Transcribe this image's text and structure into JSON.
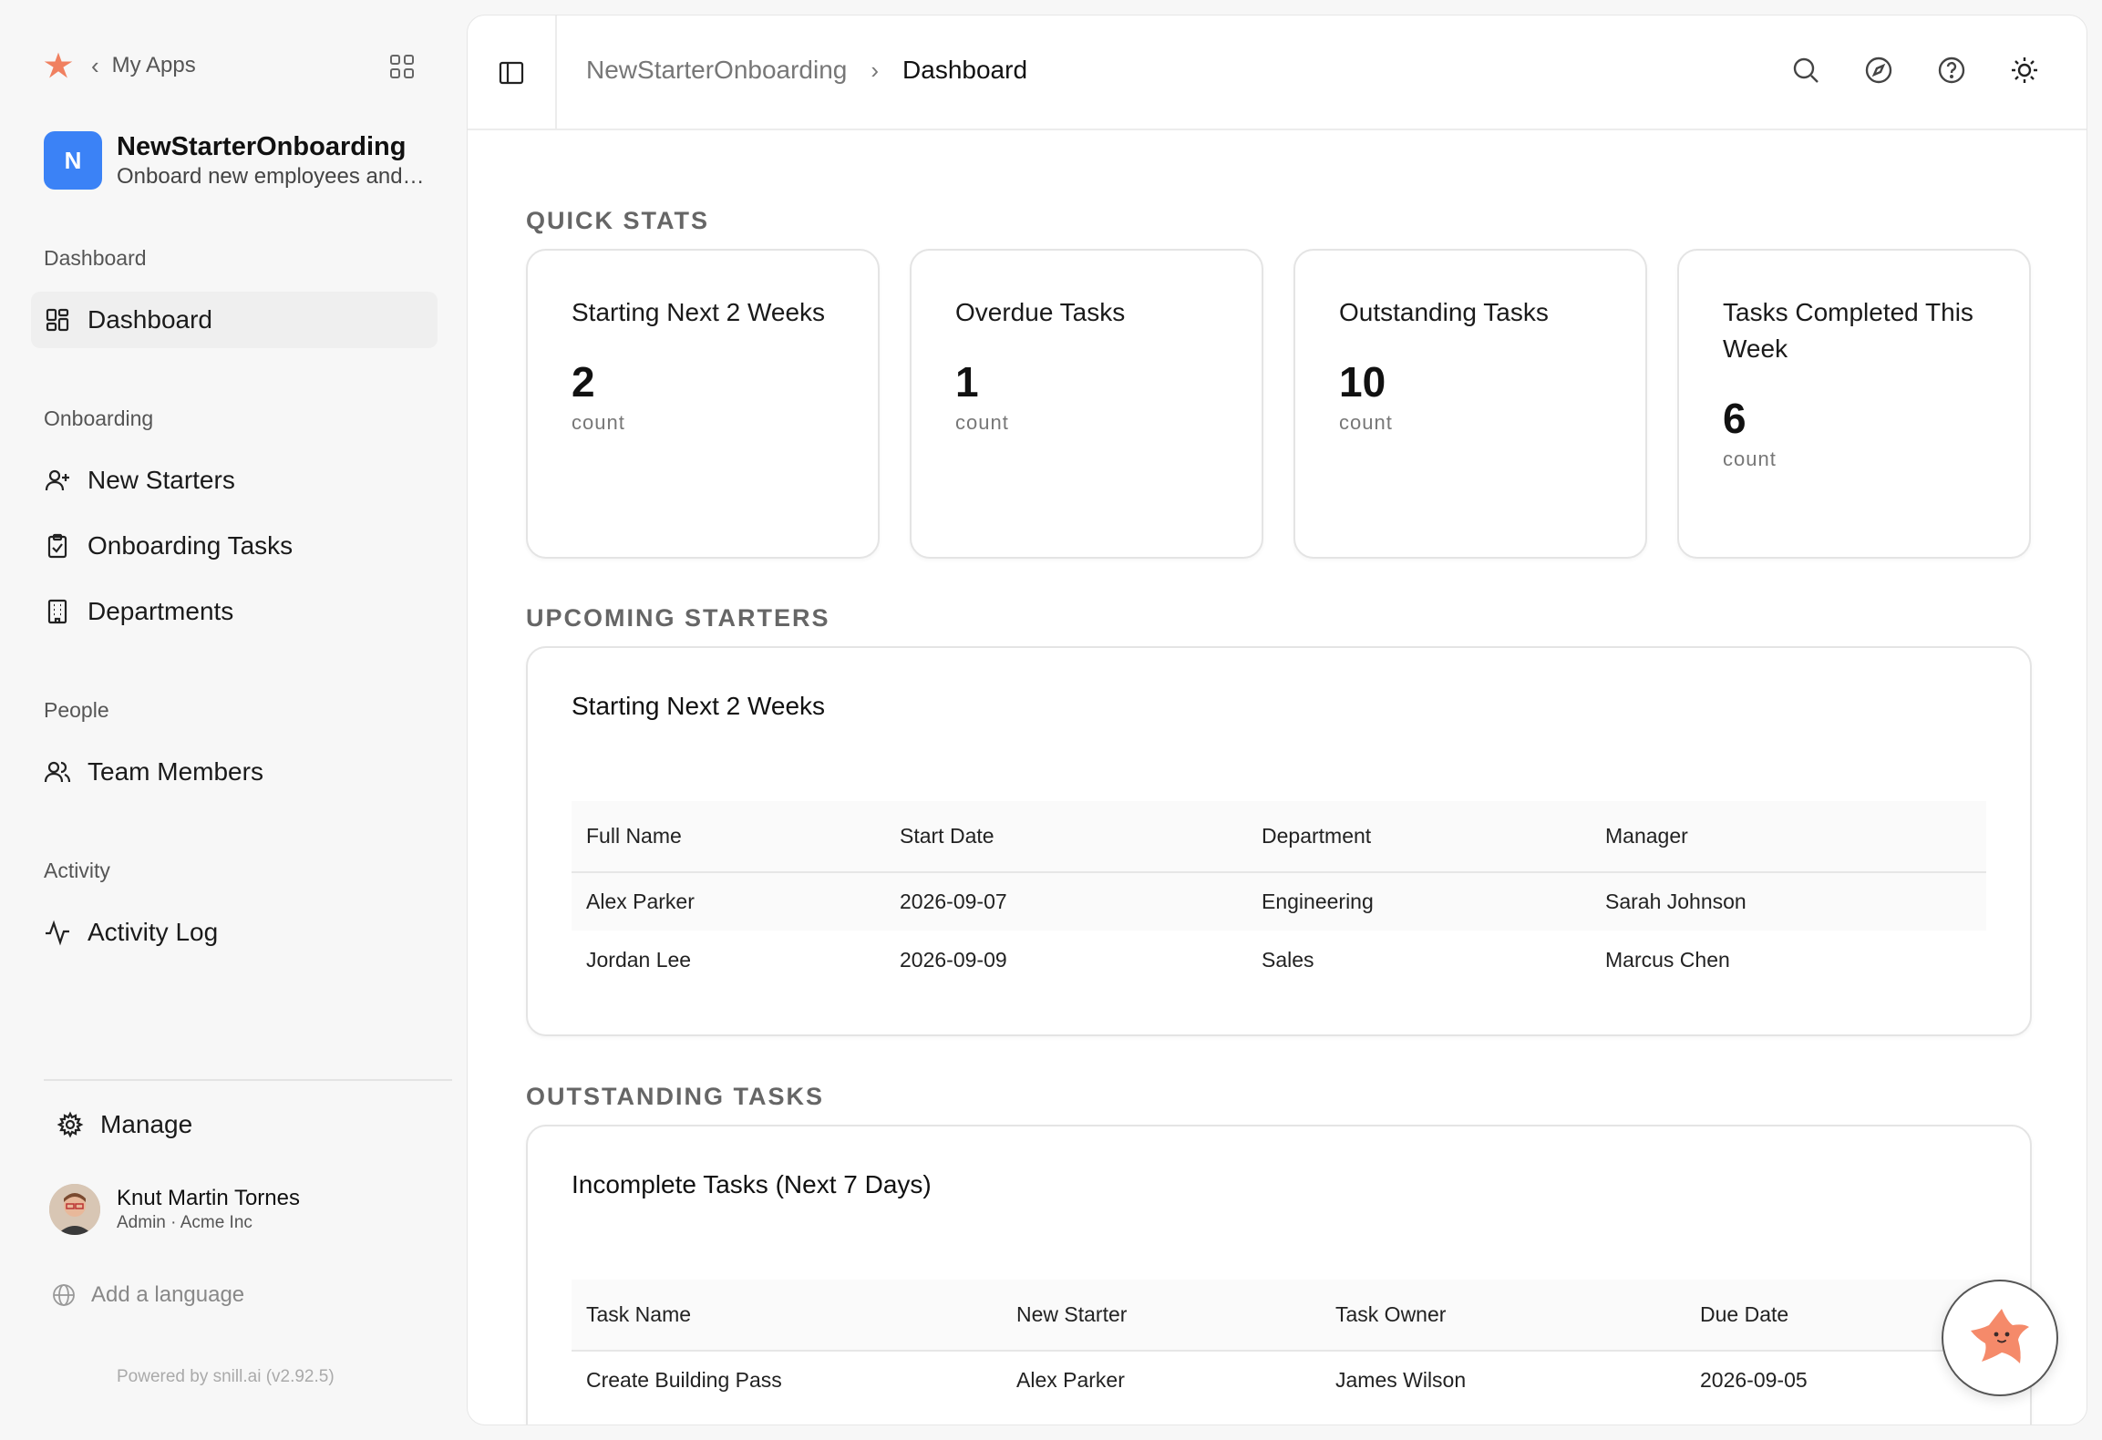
{
  "topnav": {
    "back_label": "My Apps"
  },
  "app": {
    "initial": "N",
    "name": "NewStarterOnboarding",
    "description": "Onboard new employees and track their progress"
  },
  "sidebar": {
    "sections": [
      {
        "label": "Dashboard",
        "items": [
          {
            "label": "Dashboard",
            "icon": "dashboard-icon",
            "active": true
          }
        ]
      },
      {
        "label": "Onboarding",
        "items": [
          {
            "label": "New Starters",
            "icon": "user-plus-icon"
          },
          {
            "label": "Onboarding Tasks",
            "icon": "clipboard-check-icon"
          },
          {
            "label": "Departments",
            "icon": "building-icon"
          }
        ]
      },
      {
        "label": "People",
        "items": [
          {
            "label": "Team Members",
            "icon": "users-icon"
          }
        ]
      },
      {
        "label": "Activity",
        "items": [
          {
            "label": "Activity Log",
            "icon": "activity-icon"
          }
        ]
      }
    ],
    "manage_label": "Manage",
    "user": {
      "name": "Knut Martin Tornes",
      "role": "Admin · Acme Inc"
    },
    "add_language": "Add a language",
    "powered_by": "Powered by snill.ai (v2.92.5)"
  },
  "header": {
    "breadcrumb": [
      "NewStarterOnboarding",
      "Dashboard"
    ],
    "icons": [
      "search-icon",
      "compass-icon",
      "help-icon",
      "sun-icon"
    ]
  },
  "sections": {
    "quick_stats": "QUICK STATS",
    "upcoming": "UPCOMING STARTERS",
    "outstanding": "OUTSTANDING TASKS"
  },
  "stats": [
    {
      "title": "Starting Next 2 Weeks",
      "value": "2",
      "unit": "count"
    },
    {
      "title": "Overdue Tasks",
      "value": "1",
      "unit": "count"
    },
    {
      "title": "Outstanding Tasks",
      "value": "10",
      "unit": "count"
    },
    {
      "title": "Tasks Completed This Week",
      "value": "6",
      "unit": "count"
    }
  ],
  "starters": {
    "title": "Starting Next 2 Weeks",
    "columns": [
      "Full Name",
      "Start Date",
      "Department",
      "Manager"
    ],
    "rows": [
      [
        "Alex Parker",
        "2026-09-07",
        "Engineering",
        "Sarah Johnson"
      ],
      [
        "Jordan Lee",
        "2026-09-09",
        "Sales",
        "Marcus Chen"
      ]
    ]
  },
  "tasks": {
    "title": "Incomplete Tasks (Next 7 Days)",
    "columns": [
      "Task Name",
      "New Starter",
      "Task Owner",
      "Due Date"
    ],
    "rows": [
      [
        "Create Building Pass",
        "Alex Parker",
        "James Wilson",
        "2026-09-05"
      ]
    ]
  },
  "colors": {
    "accent": "#3b82f6",
    "brand": "#f08060"
  }
}
